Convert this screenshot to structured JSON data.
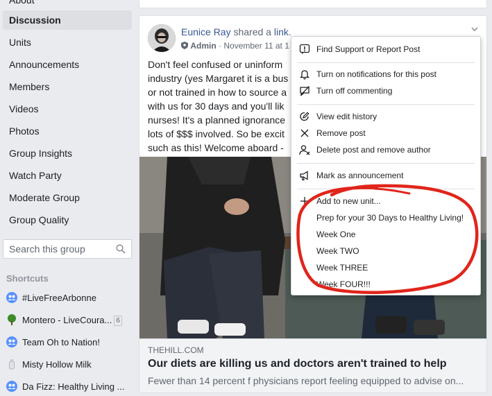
{
  "sidebar": {
    "top_partial": "About",
    "items": [
      {
        "label": "Discussion",
        "active": true
      },
      {
        "label": "Units"
      },
      {
        "label": "Announcements"
      },
      {
        "label": "Members"
      },
      {
        "label": "Videos"
      },
      {
        "label": "Photos"
      },
      {
        "label": "Group Insights"
      },
      {
        "label": "Watch Party"
      },
      {
        "label": "Moderate Group"
      },
      {
        "label": "Group Quality"
      }
    ],
    "search_placeholder": "Search this group",
    "shortcuts_title": "Shortcuts",
    "shortcuts": [
      {
        "label": "#LiveFreeArbonne",
        "icon": "group-icon"
      },
      {
        "label": "Montero - LiveCoura...",
        "icon": "tree-icon",
        "badge": "6"
      },
      {
        "label": "Team Oh to Nation!",
        "icon": "group-icon"
      },
      {
        "label": "Misty Hollow Milk",
        "icon": "bottle-icon"
      },
      {
        "label": "Da Fizz: Healthy Living ...",
        "icon": "group-icon"
      }
    ]
  },
  "post": {
    "author": "Eunice Ray",
    "shared_text": "shared a",
    "link_text": "link.",
    "role": "Admin",
    "separator": "·",
    "date": "November 11 at 1",
    "text_lines": [
      "Don't feel confused or uninform",
      "industry (yes Margaret it is a bus",
      "or not trained in how to source a",
      "with us for 30 days and you'll lik",
      "nurses! It's a planned ignorance",
      "lots of $$$ involved. So be excit",
      "such as this! Welcome aboard -"
    ],
    "link_domain": "THEHILL.COM",
    "link_title": "Our diets are killing us and doctors aren't trained to help",
    "link_description": "Fewer than 14 percent f physicians report feeling equipped to advise on..."
  },
  "menu": {
    "groups": [
      [
        {
          "label": "Find Support or Report Post",
          "icon": "report-icon"
        }
      ],
      [
        {
          "label": "Turn on notifications for this post",
          "icon": "bell-icon"
        },
        {
          "label": "Turn off commenting",
          "icon": "comment-off-icon"
        }
      ],
      [
        {
          "label": "View edit history",
          "icon": "edit-history-icon"
        },
        {
          "label": "Remove post",
          "icon": "close-icon"
        },
        {
          "label": "Delete post and remove author",
          "icon": "remove-user-icon"
        }
      ],
      [
        {
          "label": "Mark as announcement",
          "icon": "megaphone-icon"
        }
      ],
      [
        {
          "label": "Add to new unit...",
          "icon": "plus-icon"
        },
        {
          "label": "Prep for your 30 Days to Healthy Living!",
          "icon": ""
        },
        {
          "label": "Week One",
          "icon": ""
        },
        {
          "label": "Week TWO",
          "icon": ""
        },
        {
          "label": "Week THREE",
          "icon": ""
        },
        {
          "label": "Week FOUR!!!",
          "icon": ""
        }
      ]
    ]
  },
  "colors": {
    "background": "#e9ebee",
    "link_blue": "#385898",
    "annotation_red": "#e0251b"
  }
}
